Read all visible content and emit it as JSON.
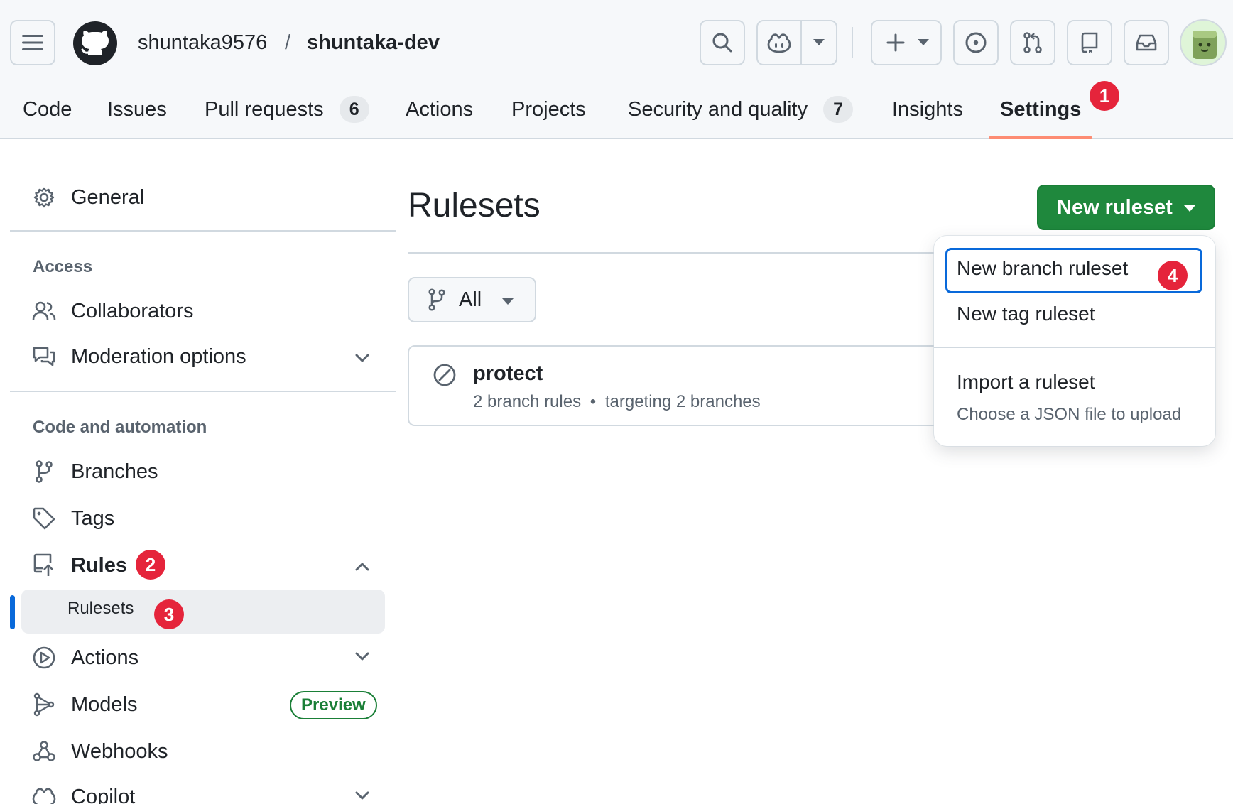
{
  "header": {
    "owner": "shuntaka9576",
    "separator": "/",
    "repo": "shuntaka-dev",
    "icons": [
      "hamburger-menu-icon",
      "github-logo-icon",
      "search-icon",
      "copilot-icon",
      "plus-icon",
      "issue-icon",
      "pull-request-icon",
      "repo-icon",
      "inbox-icon"
    ]
  },
  "nav": {
    "tabs": [
      {
        "label": "Code"
      },
      {
        "label": "Issues"
      },
      {
        "label": "Pull requests",
        "count": "6"
      },
      {
        "label": "Actions"
      },
      {
        "label": "Projects"
      },
      {
        "label": "Security and quality",
        "count": "7"
      },
      {
        "label": "Insights"
      },
      {
        "label": "Settings",
        "active": true
      }
    ]
  },
  "steps": [
    "1",
    "2",
    "3",
    "4"
  ],
  "sidebar": {
    "general": "General",
    "access_heading": "Access",
    "collaborators": "Collaborators",
    "moderation": "Moderation options",
    "code_heading": "Code and automation",
    "branches": "Branches",
    "tags": "Tags",
    "rules": "Rules",
    "rulesets": "Rulesets",
    "actions": "Actions",
    "models": "Models",
    "models_badge": "Preview",
    "webhooks": "Webhooks",
    "copilot": "Copilot"
  },
  "main": {
    "title": "Rulesets",
    "new_button": "New ruleset",
    "filter": "All",
    "ruleset": {
      "name": "protect",
      "rules": "2 branch rules",
      "dot": "•",
      "targets": "targeting 2 branches"
    }
  },
  "menu": {
    "branch": "New branch ruleset",
    "tag": "New tag ruleset",
    "import": "Import a ruleset",
    "import_desc": "Choose a JSON file to upload"
  },
  "colors": {
    "accent": "#0969da",
    "primary_green": "#1f883d",
    "step_badge": "#e5243b",
    "tab_underline": "#fd8c73"
  }
}
